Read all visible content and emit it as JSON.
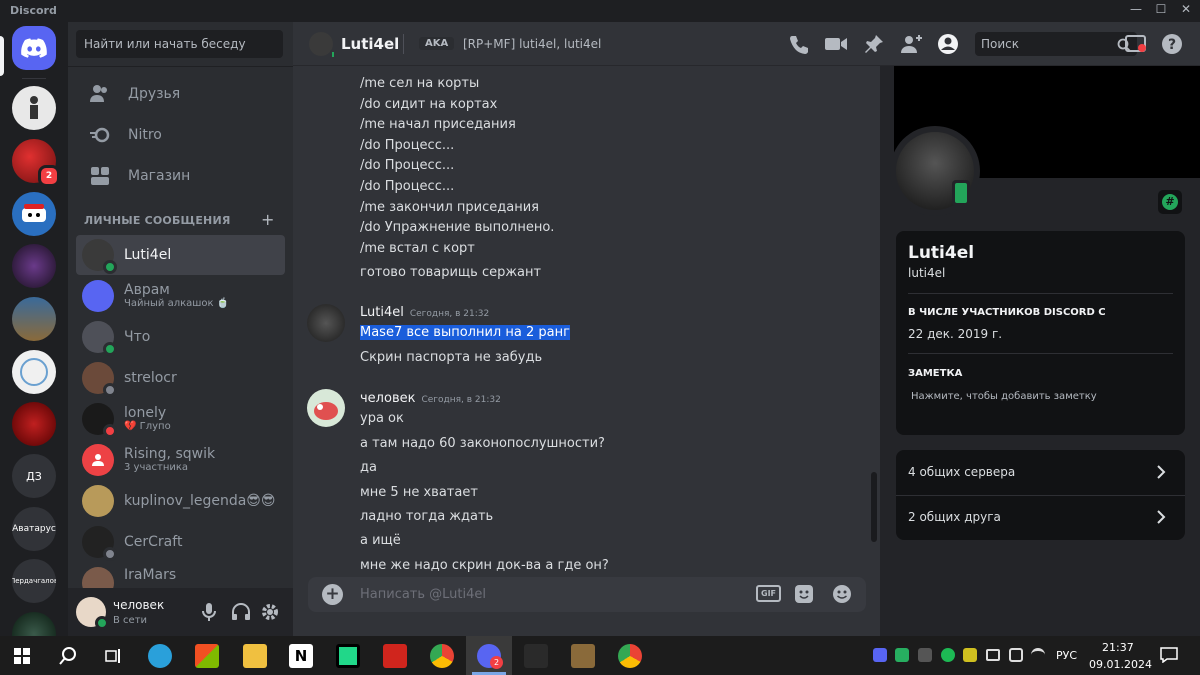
{
  "window": {
    "title": "Discord",
    "minimize": "—",
    "maximize": "☐",
    "close": "✕"
  },
  "guilds": {
    "text_servers": [
      "ДЗ",
      "Аватарус",
      "Пердачгалов"
    ],
    "badge": "2"
  },
  "sidebar": {
    "search_placeholder": "Найти или начать беседу",
    "nav": [
      {
        "label": "Друзья",
        "icon": "friends-icon"
      },
      {
        "label": "Nitro",
        "icon": "nitro-icon"
      },
      {
        "label": "Магазин",
        "icon": "shop-icon"
      }
    ],
    "dm_header": "ЛИЧНЫЕ СООБЩЕНИЯ",
    "dm_add": "+",
    "dms": [
      {
        "name": "Luti4el",
        "sub": "",
        "color": "#3a3a3a",
        "status": "#23a55a"
      },
      {
        "name": "Аврам",
        "sub": "Чайный алкашок 🍵",
        "color": "#5865f2",
        "status": ""
      },
      {
        "name": "Что",
        "sub": "",
        "color": "#4e5058",
        "status": "#23a55a"
      },
      {
        "name": "strelocr",
        "sub": "",
        "color": "#6b4a3a",
        "status": "#80848e"
      },
      {
        "name": "lonely",
        "sub": "💔 Глупо",
        "color": "#1a1a1a",
        "status": "#f23f43"
      },
      {
        "name": "Rising, sqwik",
        "sub": "3 участника",
        "color": "#ed4245",
        "status": ""
      },
      {
        "name": "kuplinov_legenda😎😎",
        "sub": "",
        "color": "#b89a5a",
        "status": ""
      },
      {
        "name": "CerCraft",
        "sub": "",
        "color": "#222222",
        "status": "#80848e"
      },
      {
        "name": "IraMars",
        "sub": "",
        "color": "#7a5a4a",
        "status": ""
      }
    ]
  },
  "user_panel": {
    "name": "человек",
    "status": "В сети"
  },
  "header": {
    "channel_name": "Luti4el",
    "aka_label": "AKA",
    "aka_names": "[RP+MF] luti4el, luti4el",
    "search_placeholder": "Поиск"
  },
  "messages": {
    "block1": [
      "/me сел на корты",
      "/do сидит на кортах",
      "/me начал приседания",
      "/do Процесс...",
      "/do Процесс...",
      "/do Процесс...",
      "/me закончил приседания",
      "/do Упражнение выполнено.",
      "/me встал с корт",
      "готово товарищь сержант"
    ],
    "group2": {
      "author": "Luti4el",
      "time": "Сегодня, в 21:32",
      "lines": [
        "Mase7  все выполнил на 2 ранг",
        "Скрин паспорта не забудь"
      ]
    },
    "group3": {
      "author": "человек",
      "time": "Сегодня, в 21:32",
      "lines": [
        "ура ок",
        "а там надо 60 законопослушности?",
        "да",
        "мне 5 не хватает",
        "ладно тогда ждать",
        "а ищё",
        "мне же надо скрин док-ва а где он?"
      ]
    }
  },
  "composer": {
    "placeholder": "Написать @Luti4el",
    "gif": "GIF"
  },
  "profile": {
    "display_name": "Luti4el",
    "username": "luti4el",
    "member_since_label": "В ЧИСЛЕ УЧАСТНИКОВ DISCORD С",
    "member_since": "22 дек. 2019 г.",
    "note_label": "ЗАМЕТКА",
    "note_placeholder": "Нажмите, чтобы добавить заметку",
    "mutual_servers": "4 общих сервера",
    "mutual_friends": "2 общих друга",
    "badge": "#"
  },
  "taskbar": {
    "time": "21:37",
    "date": "09.01.2024",
    "lang": "РУС",
    "discord_badge": "2"
  },
  "colors": {
    "accent": "#5865f2",
    "online": "#23a55a",
    "dnd": "#f23f43",
    "highlight": "#1a5ddb"
  }
}
